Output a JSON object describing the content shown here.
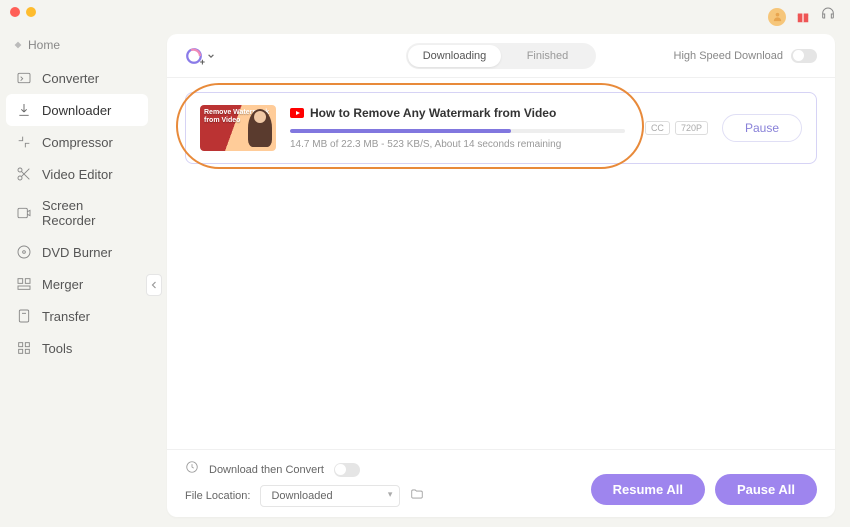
{
  "sidebar": {
    "home": "Home",
    "items": [
      {
        "label": "Converter"
      },
      {
        "label": "Downloader"
      },
      {
        "label": "Compressor"
      },
      {
        "label": "Video Editor"
      },
      {
        "label": "Screen Recorder"
      },
      {
        "label": "DVD Burner"
      },
      {
        "label": "Merger"
      },
      {
        "label": "Transfer"
      },
      {
        "label": "Tools"
      }
    ]
  },
  "tabs": {
    "downloading": "Downloading",
    "finished": "Finished"
  },
  "high_speed_label": "High Speed Download",
  "download": {
    "title": "How to Remove Any Watermark from Video",
    "thumb_overlay": "Remove Watermark from Video",
    "status": "14.7 MB of 22.3 MB - 523 KB/S, About 14 seconds remaining",
    "progress_pct": 66,
    "badge_cc": "CC",
    "badge_res": "720P",
    "pause_label": "Pause"
  },
  "footer": {
    "convert_label": "Download then Convert",
    "file_location_label": "File Location:",
    "location_value": "Downloaded",
    "resume_all": "Resume All",
    "pause_all": "Pause All"
  }
}
